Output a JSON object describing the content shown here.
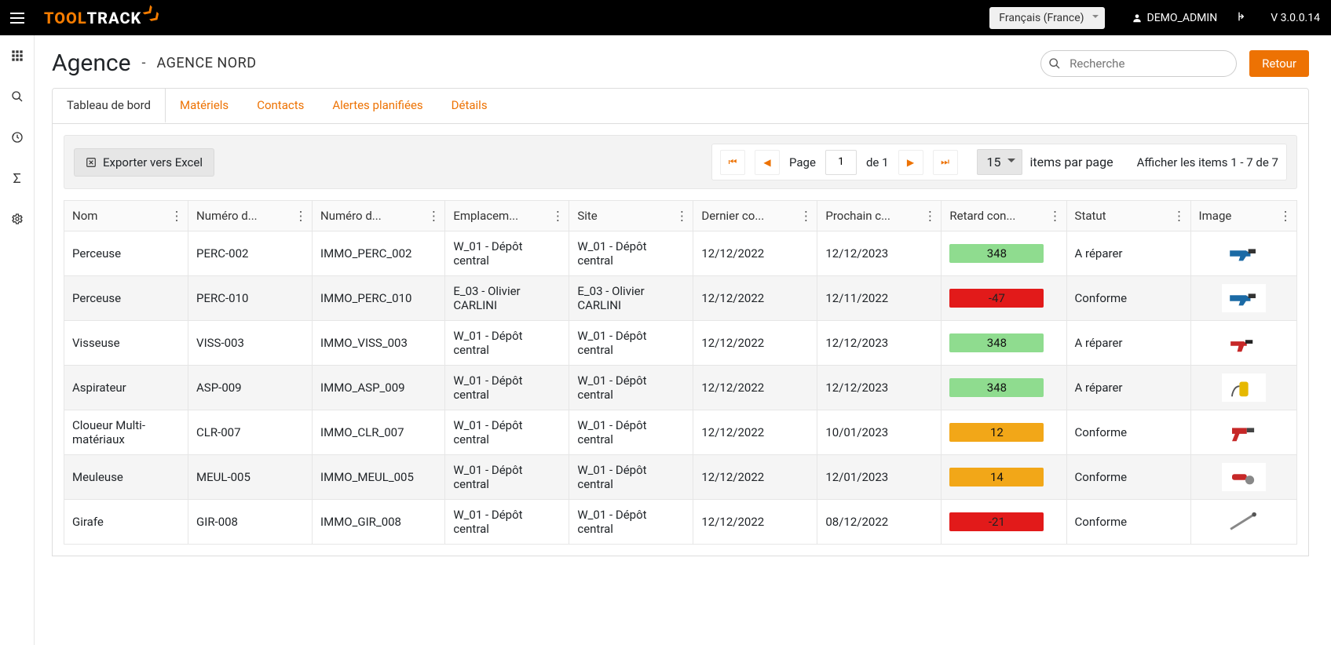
{
  "header": {
    "language": "Français (France)",
    "user": "DEMO_ADMIN",
    "version": "V 3.0.0.14"
  },
  "page": {
    "title": "Agence",
    "separator": "-",
    "agency": "AGENCE NORD",
    "search_placeholder": "Recherche",
    "return_label": "Retour"
  },
  "tabs": [
    {
      "label": "Tableau de bord",
      "active": true
    },
    {
      "label": "Matériels",
      "active": false
    },
    {
      "label": "Contacts",
      "active": false
    },
    {
      "label": "Alertes planifiées",
      "active": false
    },
    {
      "label": "Détails",
      "active": false
    }
  ],
  "toolbar": {
    "export_label": "Exporter vers Excel",
    "page_label": "Page",
    "page_current": "1",
    "page_of": "de 1",
    "per_page_value": "15",
    "per_page_label": "items par page",
    "items_info": "Afficher les items 1 - 7 de 7"
  },
  "columns": [
    "Nom",
    "Numéro d...",
    "Numéro d...",
    "Emplacem...",
    "Site",
    "Dernier co...",
    "Prochain c...",
    "Retard con...",
    "Statut",
    "Image"
  ],
  "rows": [
    {
      "nom": "Perceuse",
      "num1": "PERC-002",
      "num2": "IMMO_PERC_002",
      "emp": "W_01 - Dépôt central",
      "site": "W_01 - Dépôt central",
      "dc": "12/12/2022",
      "pc": "12/12/2023",
      "rc": "348",
      "rc_class": "green",
      "stat": "A réparer",
      "img": "drill-blue"
    },
    {
      "nom": "Perceuse",
      "num1": "PERC-010",
      "num2": "IMMO_PERC_010",
      "emp": "E_03 - Olivier CARLINI",
      "site": "E_03 - Olivier CARLINI",
      "dc": "12/12/2022",
      "pc": "12/11/2022",
      "rc": "-47",
      "rc_class": "red",
      "stat": "Conforme",
      "img": "drill-blue"
    },
    {
      "nom": "Visseuse",
      "num1": "VISS-003",
      "num2": "IMMO_VISS_003",
      "emp": "W_01 - Dépôt central",
      "site": "W_01 - Dépôt central",
      "dc": "12/12/2022",
      "pc": "12/12/2023",
      "rc": "348",
      "rc_class": "green",
      "stat": "A réparer",
      "img": "driver-red"
    },
    {
      "nom": "Aspirateur",
      "num1": "ASP-009",
      "num2": "IMMO_ASP_009",
      "emp": "W_01 - Dépôt central",
      "site": "W_01 - Dépôt central",
      "dc": "12/12/2022",
      "pc": "12/12/2023",
      "rc": "348",
      "rc_class": "green",
      "stat": "A réparer",
      "img": "vacuum"
    },
    {
      "nom": "Cloueur Multi-matériaux",
      "num1": "CLR-007",
      "num2": "IMMO_CLR_007",
      "emp": "W_01 - Dépôt central",
      "site": "W_01 - Dépôt central",
      "dc": "12/12/2022",
      "pc": "10/01/2023",
      "rc": "12",
      "rc_class": "orange",
      "stat": "Conforme",
      "img": "nailer"
    },
    {
      "nom": "Meuleuse",
      "num1": "MEUL-005",
      "num2": "IMMO_MEUL_005",
      "emp": "W_01 - Dépôt central",
      "site": "W_01 - Dépôt central",
      "dc": "12/12/2022",
      "pc": "12/01/2023",
      "rc": "14",
      "rc_class": "orange",
      "stat": "Conforme",
      "img": "grinder"
    },
    {
      "nom": "Girafe",
      "num1": "GIR-008",
      "num2": "IMMO_GIR_008",
      "emp": "W_01 - Dépôt central",
      "site": "W_01 - Dépôt central",
      "dc": "12/12/2022",
      "pc": "08/12/2022",
      "rc": "-21",
      "rc_class": "red",
      "stat": "Conforme",
      "img": "pole"
    }
  ]
}
